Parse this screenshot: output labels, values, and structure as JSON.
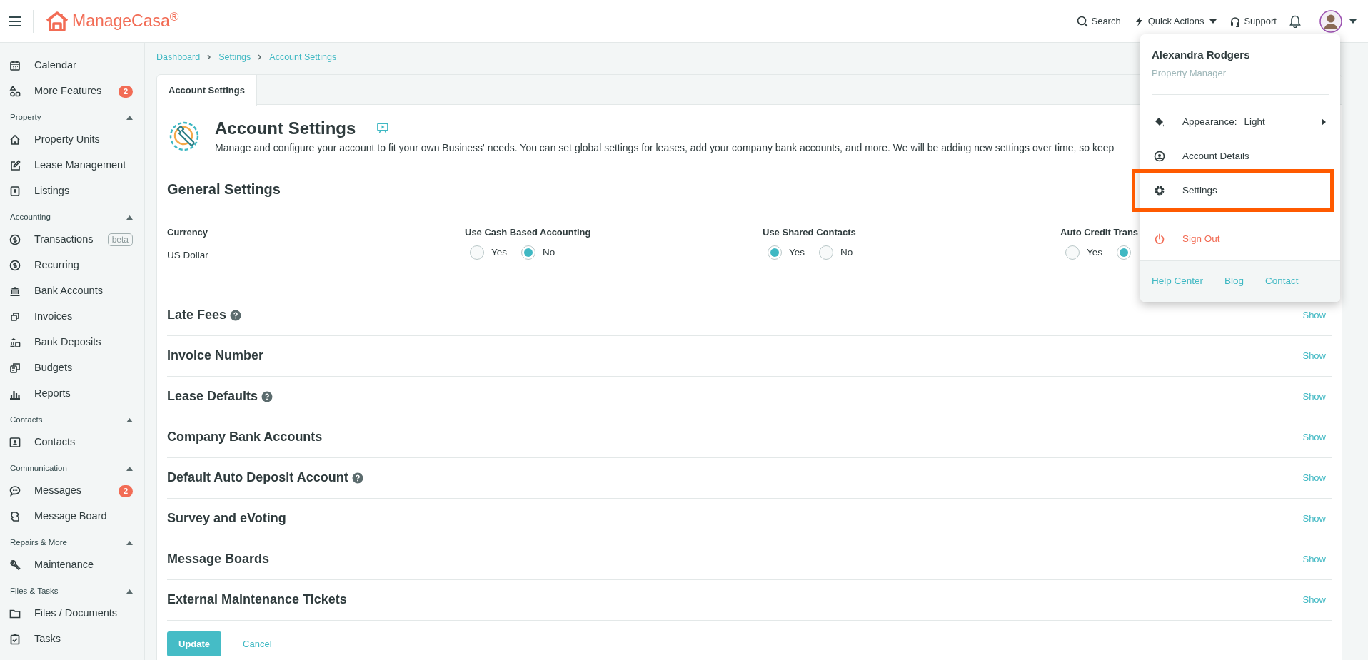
{
  "top_bar": {
    "brand": "ManageCasa$^{®}$",
    "actions": [
      {
        "kind": "search",
        "label": "Search"
      },
      {
        "kind": "quick",
        "label": "Quick Actions"
      },
      {
        "kind": "support",
        "label": "Support"
      }
    ]
  },
  "sidebar": {
    "groups": [
      {
        "items": [
          {
            "label": "Calendar"
          },
          {
            "label": "More Features",
            "badge": "2"
          }
        ]
      },
      {
        "heading": "Property",
        "expanded": true,
        "items": [
          {
            "label": "Property Units"
          },
          {
            "label": "Lease Management"
          },
          {
            "label": "Listings"
          }
        ]
      },
      {
        "heading": "Accounting",
        "expanded": true,
        "items": [
          {
            "label": "Transactions",
            "tag": "beta"
          },
          {
            "label": "Recurring"
          },
          {
            "label": "Bank Accounts"
          },
          {
            "label": "Invoices"
          },
          {
            "label": "Bank Deposits"
          },
          {
            "label": "Budgets"
          },
          {
            "label": "Reports"
          }
        ]
      },
      {
        "heading": "Contacts",
        "expanded": true,
        "items": [
          {
            "label": "Contacts"
          }
        ]
      },
      {
        "heading": "Communication",
        "expanded": true,
        "items": [
          {
            "label": "Messages",
            "badge": "2"
          },
          {
            "label": "Message Board"
          }
        ]
      },
      {
        "heading": "Repairs & More",
        "expanded": true,
        "items": [
          {
            "label": "Maintenance"
          }
        ]
      },
      {
        "heading": "Files & Tasks",
        "expanded": true,
        "items": [
          {
            "label": "Files / Documents"
          },
          {
            "label": "Tasks"
          }
        ]
      }
    ]
  },
  "breadcrumb": [
    "Dashboard",
    "Settings",
    "Account Settings"
  ],
  "tabs": [
    {
      "label": "Account Settings",
      "selected": true
    }
  ],
  "header": {
    "title": "Account Settings",
    "description": "Manage and configure your account to fit your own Business' needs. You can set global settings for leases, add your company bank accounts, and more. We will be adding new settings over time, so keep"
  },
  "general": {
    "title": "General Settings",
    "fields": [
      {
        "kind": "text",
        "label": "Currency",
        "value": "US Dollar"
      },
      {
        "kind": "radio",
        "label": "Use Cash Based Accounting",
        "options": [
          {
            "label": "Yes",
            "selected": false
          },
          {
            "label": "No",
            "selected": true
          }
        ]
      },
      {
        "kind": "radio",
        "label": "Use Shared Contacts",
        "options": [
          {
            "label": "Yes",
            "selected": true
          },
          {
            "label": "No",
            "selected": false
          }
        ]
      },
      {
        "kind": "radio",
        "label": "Auto Credit Trans",
        "options": [
          {
            "label": "Yes",
            "selected": false
          },
          {
            "selected": true
          }
        ]
      }
    ]
  },
  "sections": [
    {
      "title": "Late Fees",
      "help": true,
      "action": "Show"
    },
    {
      "title": "Invoice Number",
      "help": false,
      "action": "Show"
    },
    {
      "title": "Lease Defaults",
      "help": true,
      "action": "Show"
    },
    {
      "title": "Company Bank Accounts",
      "help": false,
      "action": "Show"
    },
    {
      "title": "Default Auto Deposit Account",
      "help": true,
      "action": "Show"
    },
    {
      "title": "Survey and eVoting",
      "help": false,
      "action": "Show"
    },
    {
      "title": "Message Boards",
      "help": false,
      "action": "Show"
    },
    {
      "title": "External Maintenance Tickets",
      "help": false,
      "action": "Show"
    }
  ],
  "buttons": {
    "update": "Update",
    "cancel": "Cancel"
  },
  "user_menu": {
    "name": "Alexandra Rodgers",
    "role": "Property Manager",
    "items": [
      {
        "kind": "appearance",
        "label": "Appearance:",
        "value": "Light",
        "highlighted": false
      },
      {
        "kind": "account",
        "label": "Account Details",
        "highlighted": false
      },
      {
        "kind": "settings",
        "label": "Settings",
        "highlighted": true
      },
      {
        "kind": "signout",
        "label": "Sign Out",
        "highlighted": false
      }
    ],
    "footer_links": [
      "Help Center",
      "Blog",
      "Contact"
    ]
  }
}
